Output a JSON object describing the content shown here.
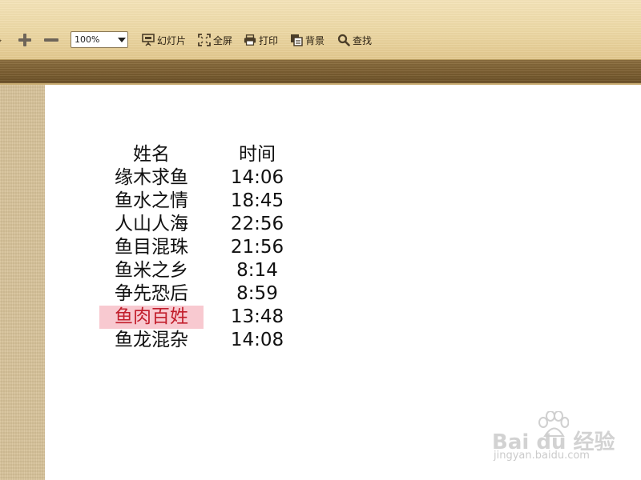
{
  "toolbar": {
    "zoom_value": "100%",
    "slideshow_label": "幻灯片",
    "fullscreen_label": "全屏",
    "print_label": "打印",
    "background_label": "背景",
    "find_label": "查找",
    "icons": [
      "rotate-icon",
      "zoom-in-icon",
      "zoom-out-icon",
      "chevron-down-icon",
      "slideshow-icon",
      "fullscreen-icon",
      "print-icon",
      "background-icon",
      "search-icon"
    ]
  },
  "document": {
    "header": [
      "姓名",
      "时间"
    ],
    "rows": [
      [
        "缘木求鱼",
        "14:06"
      ],
      [
        "鱼水之情",
        "18:45"
      ],
      [
        "人山人海",
        "22:56"
      ],
      [
        "鱼目混珠",
        "21:56"
      ],
      [
        "鱼米之乡",
        "8:14"
      ],
      [
        "争先恐后",
        "8:59"
      ],
      [
        "鱼肉百姓",
        "13:48"
      ],
      [
        "鱼龙混杂",
        "14:08"
      ]
    ],
    "highlight_color": "#f8c9d0",
    "highlight_text_color": "#c21e2c"
  },
  "watermark": {
    "brand": "Bai du 经验",
    "url": "jingyan.baidu.com"
  },
  "colors": {
    "toolbar": "#ecd7a3",
    "band": "#7b5e31",
    "side_panel": "#d8c39a"
  }
}
